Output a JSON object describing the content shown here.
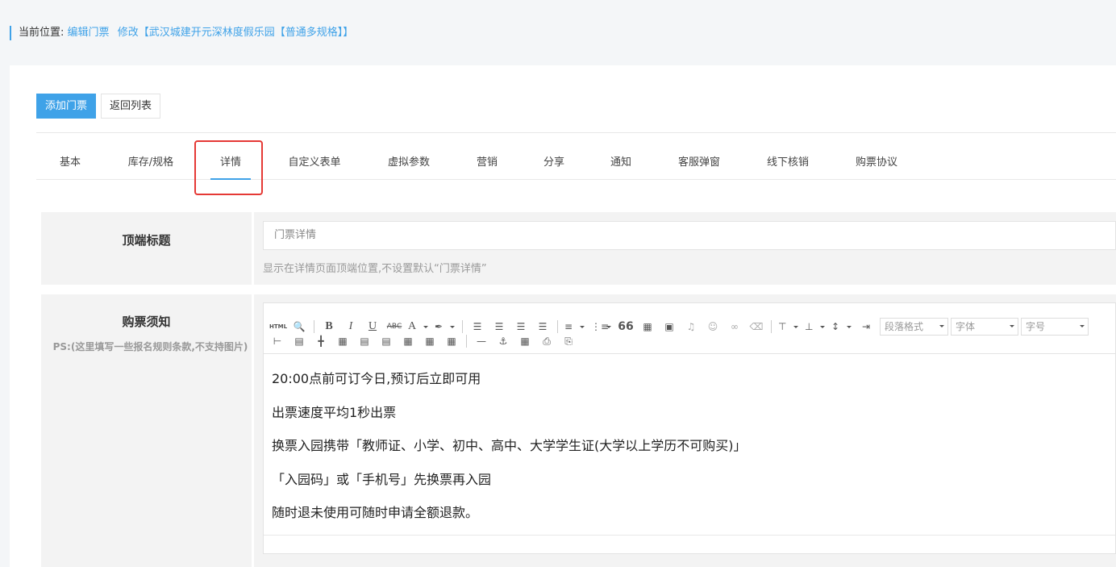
{
  "breadcrumb": {
    "label": "当前位置:",
    "link1": "编辑门票",
    "link2": "修改【武汉城建开元深林度假乐园【普通多规格】】"
  },
  "buttons": {
    "add_ticket": "添加门票",
    "back_list": "返回列表"
  },
  "tabs": [
    "基本",
    "库存/规格",
    "详情",
    "自定义表单",
    "虚拟参数",
    "营销",
    "分享",
    "通知",
    "客服弹窗",
    "线下核销",
    "购票协议"
  ],
  "active_tab": 2,
  "top_title": {
    "label": "顶端标题",
    "placeholder": "门票详情",
    "hint": "显示在详情页面顶端位置,不设置默认“门票详情”"
  },
  "notice": {
    "label": "购票须知",
    "ps": "PS:(这里填写一些报名规则条款,不支持图片)",
    "selects": {
      "paragraph": "段落格式",
      "font": "字体",
      "size": "字号"
    },
    "lines": [
      "20:00点前可订今日,预订后立即可用",
      "出票速度平均1秒出票",
      "换票入园携带「教师证、小学、初中、高中、大学学生证(大学以上学历不可购买)」",
      "「入园码」或「手机号」先换票再入园",
      "随时退未使用可随时申请全额退款。"
    ]
  },
  "icons": {
    "html": "HTML",
    "bold": "B",
    "italic": "I",
    "underline": "U",
    "strike": "ABC",
    "font_color": "A",
    "quote": "66"
  }
}
